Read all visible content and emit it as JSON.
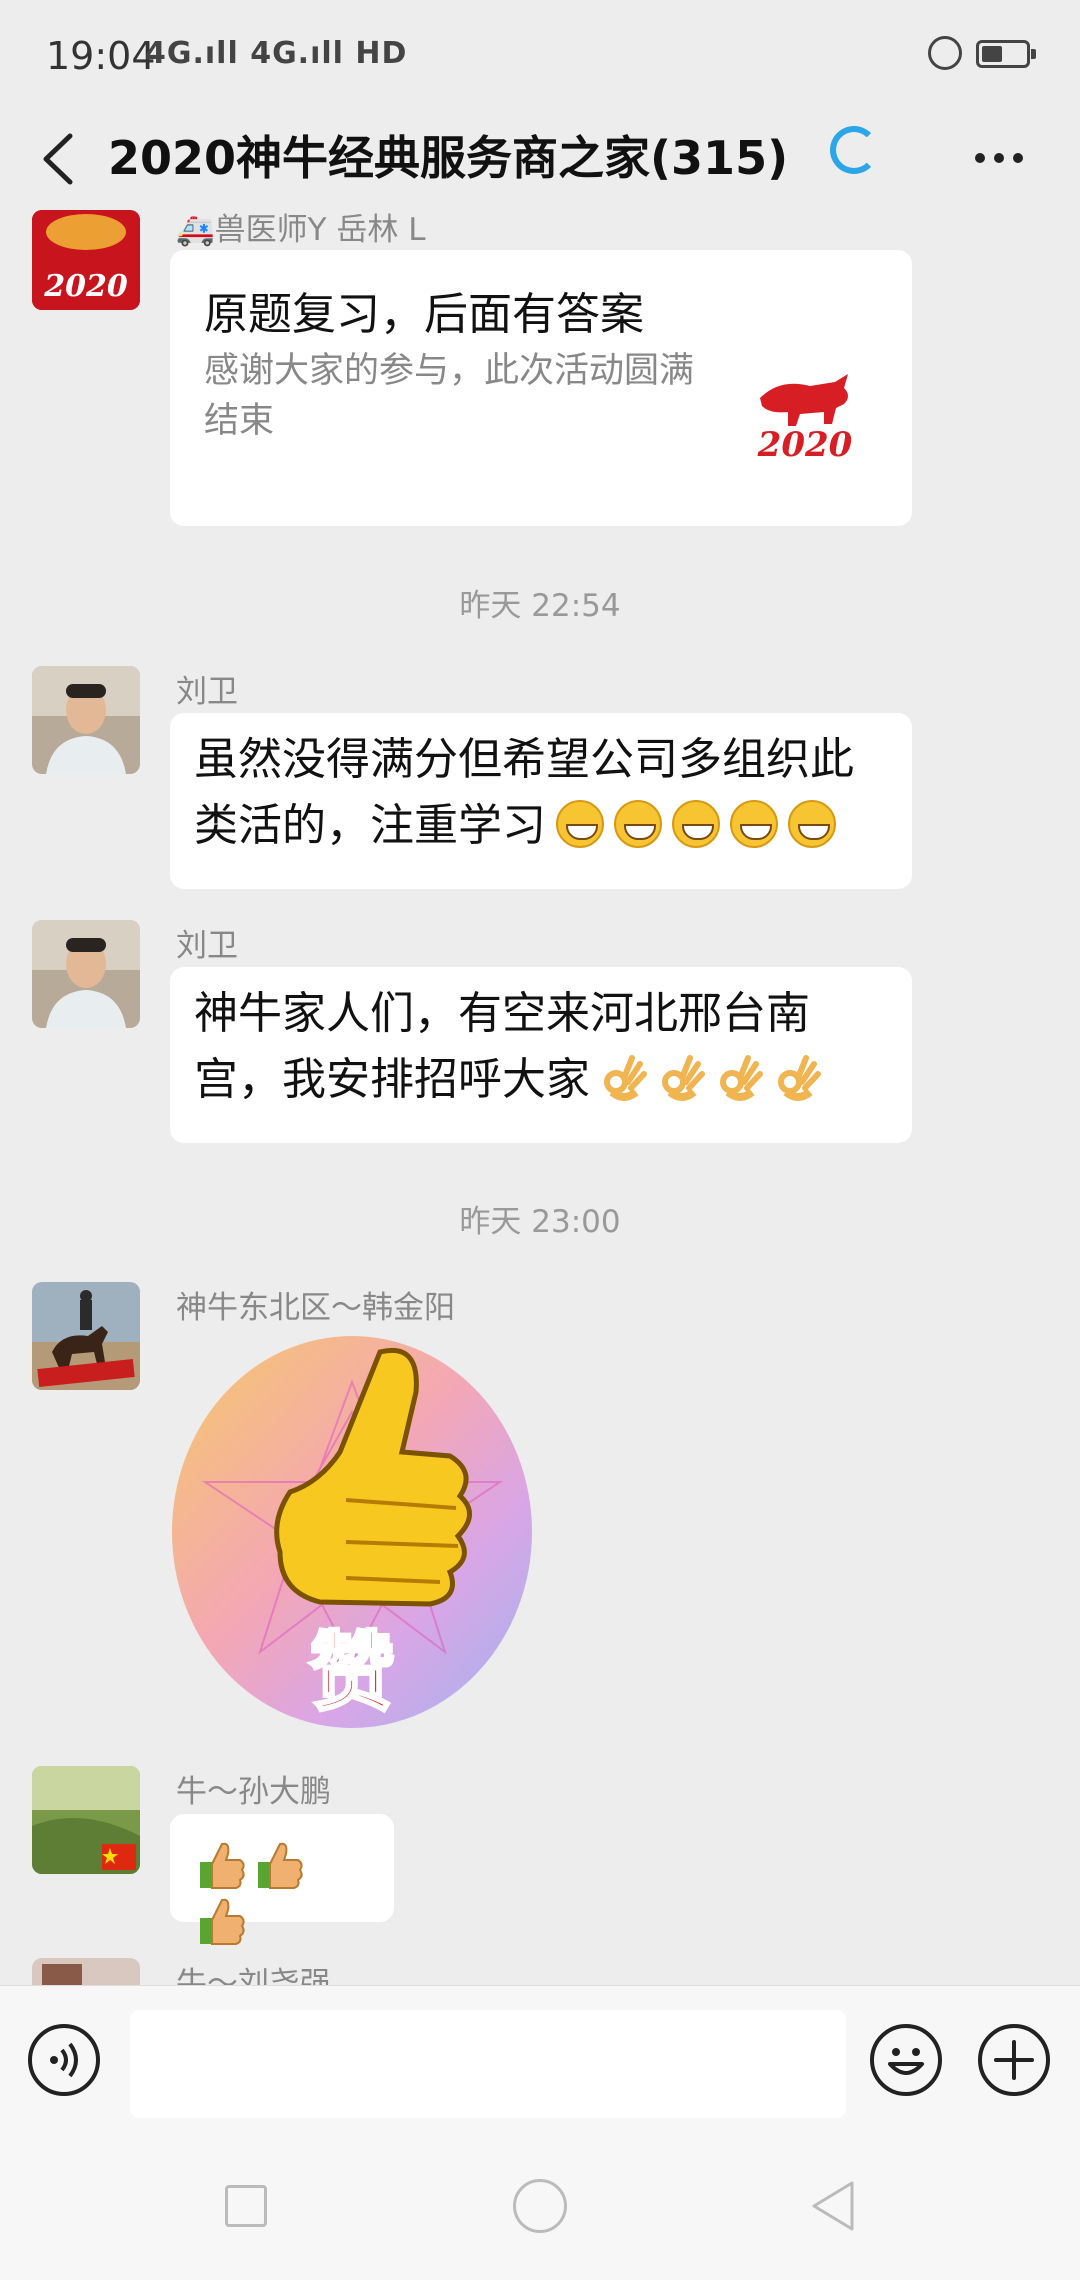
{
  "status_bar": {
    "time": "19:04",
    "signal": "4G.ıll 4G.ıll HD"
  },
  "header": {
    "title": "2020神牛经典服务商之家(315)"
  },
  "messages": [
    {
      "sender": "🚑兽医师Y 岳林 L",
      "card_title": "原题复习，后面有答案",
      "card_description": "感谢大家的参与，此次活动圆满结束",
      "card_thumb_text": "2020",
      "avatar_text": "2020"
    },
    {
      "timestamp": "昨天 22:54"
    },
    {
      "sender": "刘卫",
      "text": "虽然没得满分但希望公司多组织此类活的，注重学习"
    },
    {
      "sender": "刘卫",
      "text": "神牛家人们，有空来河北邢台南宫，我安排招呼大家"
    },
    {
      "timestamp": "昨天 23:00"
    },
    {
      "sender": "神牛东北区～韩金阳",
      "sticker_text": "赞"
    },
    {
      "sender": "牛～孙大鹏"
    },
    {
      "sender": "牛～刘尧强"
    }
  ],
  "colors": {
    "background": "#ededed",
    "accent": "#2ba6e8",
    "bubble": "#ffffff"
  }
}
